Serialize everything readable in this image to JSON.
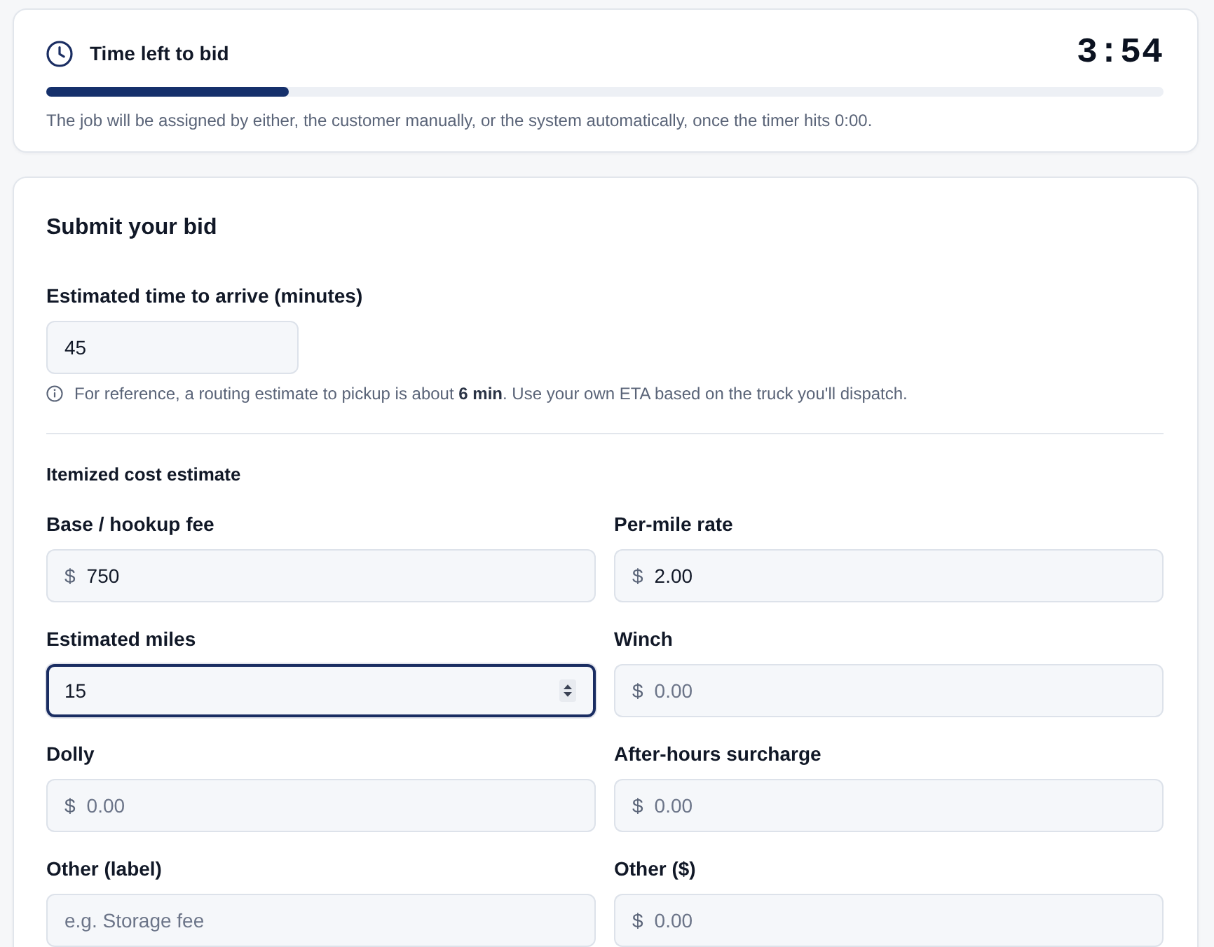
{
  "timer_card": {
    "title": "Time left to bid",
    "time_left": "3:54",
    "level": 0.217,
    "note": "The job will be assigned by either, the customer manually, or the system automatically, once the timer hits 0:00."
  },
  "bid_form": {
    "title": "Submit your bid",
    "eta": {
      "label": "Estimated time to arrive (minutes)",
      "value": "45",
      "focused": false
    },
    "eta_hint": "For reference, a routing estimate to pickup is about **6 min**. Use your own ETA based on the truck you'll dispatch.",
    "section_title": "Itemized cost estimate",
    "fields": [
      {
        "kind": "currency",
        "label": "Base / hookup fee",
        "prefix": "$",
        "value": "750",
        "focused": false
      },
      {
        "kind": "currency",
        "label": "Per-mile rate",
        "prefix": "$",
        "value": "2.00",
        "focused": false
      },
      {
        "kind": "number",
        "label": "Estimated miles",
        "value": "15",
        "focused": true
      },
      {
        "kind": "currency",
        "label": "Winch",
        "prefix": "$",
        "placeholder": "0.00",
        "focused": false
      },
      {
        "kind": "currency",
        "label": "Dolly",
        "prefix": "$",
        "placeholder": "0.00",
        "focused": false
      },
      {
        "kind": "currency",
        "label": "After-hours surcharge",
        "prefix": "$",
        "placeholder": "0.00",
        "focused": false
      },
      {
        "kind": "text",
        "label": "Other (label)",
        "placeholder": "e.g. Storage fee",
        "focused": false
      },
      {
        "kind": "currency",
        "label": "Other ($)",
        "prefix": "$",
        "placeholder": "0.00",
        "focused": false
      }
    ]
  }
}
